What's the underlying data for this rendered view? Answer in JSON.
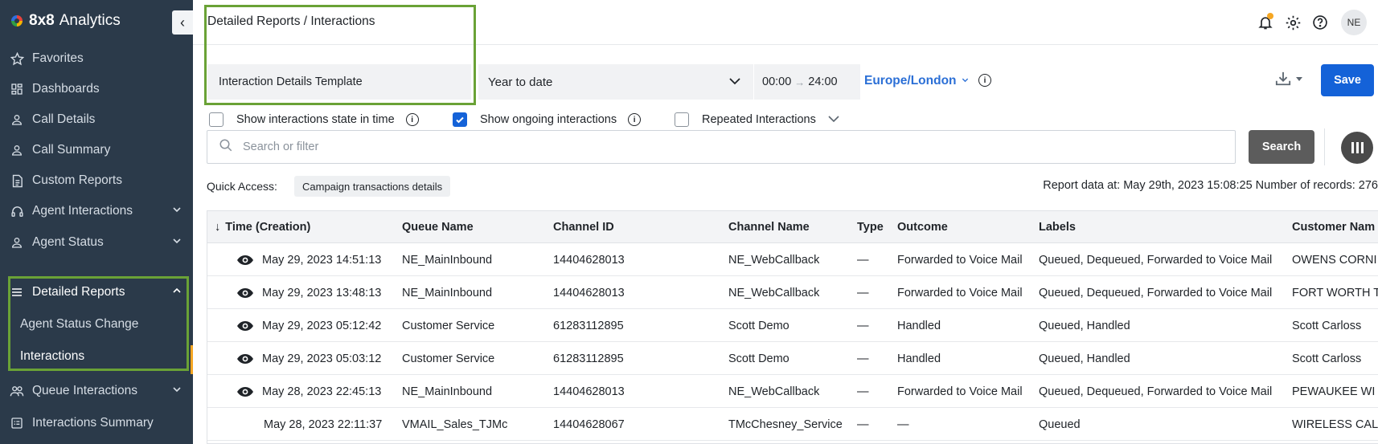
{
  "app": {
    "brand_bold": "8x8",
    "brand_name": "Analytics",
    "collapse_glyph": "‹"
  },
  "sidebar": {
    "items": [
      {
        "label": "Favorites",
        "icon": "star-icon"
      },
      {
        "label": "Dashboards",
        "icon": "dashboard-icon"
      },
      {
        "label": "Call Details",
        "icon": "person-icon"
      },
      {
        "label": "Call Summary",
        "icon": "person-icon"
      },
      {
        "label": "Custom Reports",
        "icon": "document-icon"
      },
      {
        "label": "Agent Interactions",
        "icon": "headset-icon"
      },
      {
        "label": "Agent Status",
        "icon": "person-icon"
      },
      {
        "label": "Detailed Reports",
        "icon": "list-icon"
      },
      {
        "label": "Queue Interactions",
        "icon": "group-icon"
      },
      {
        "label": "Interactions Summary",
        "icon": "summary-icon"
      }
    ],
    "sub_items": [
      {
        "label": "Agent Status Change"
      },
      {
        "label": "Interactions"
      }
    ]
  },
  "header": {
    "breadcrumb": "Detailed Reports / Interactions",
    "avatar_initials": "NE"
  },
  "filters": {
    "template": "Interaction Details Template",
    "period": "Year to date",
    "time_start": "00:00",
    "time_arrow": "→",
    "time_end": "24:00",
    "timezone": "Europe/London",
    "save_label": "Save"
  },
  "options": {
    "show_state": {
      "label": "Show interactions state in time",
      "checked": false
    },
    "show_ongoing": {
      "label": "Show ongoing interactions",
      "checked": true
    },
    "repeated": {
      "label": "Repeated Interactions",
      "checked": false
    }
  },
  "search": {
    "placeholder": "Search or filter",
    "button_label": "Search"
  },
  "quick_access": {
    "label": "Quick Access:",
    "chip": "Campaign transactions details"
  },
  "report_meta": "Report data at: May 29th, 2023 15:08:25  Number of records: 276",
  "table": {
    "sort_glyph": "↓",
    "columns": [
      "Time (Creation)",
      "Queue Name",
      "Channel ID",
      "Channel Name",
      "Type",
      "Outcome",
      "Labels",
      "Customer Nam"
    ],
    "rows": [
      {
        "has_eye": true,
        "cells": [
          "May 29, 2023 14:51:13",
          "NE_MainInbound",
          "14404628013",
          "NE_WebCallback",
          "—",
          "Forwarded to Voice Mail",
          "Queued, Dequeued, Forwarded to Voice Mail",
          "OWENS CORNI"
        ]
      },
      {
        "has_eye": true,
        "cells": [
          "May 29, 2023 13:48:13",
          "NE_MainInbound",
          "14404628013",
          "NE_WebCallback",
          "—",
          "Forwarded to Voice Mail",
          "Queued, Dequeued, Forwarded to Voice Mail",
          "FORT WORTH T"
        ]
      },
      {
        "has_eye": true,
        "cells": [
          "May 29, 2023 05:12:42",
          "Customer Service",
          "61283112895",
          "Scott Demo",
          "—",
          "Handled",
          "Queued, Handled",
          "Scott Carloss"
        ]
      },
      {
        "has_eye": true,
        "cells": [
          "May 29, 2023 05:03:12",
          "Customer Service",
          "61283112895",
          "Scott Demo",
          "—",
          "Handled",
          "Queued, Handled",
          "Scott Carloss"
        ]
      },
      {
        "has_eye": true,
        "cells": [
          "May 28, 2023 22:45:13",
          "NE_MainInbound",
          "14404628013",
          "NE_WebCallback",
          "—",
          "Forwarded to Voice Mail",
          "Queued, Dequeued, Forwarded to Voice Mail",
          "PEWAUKEE WI"
        ]
      },
      {
        "has_eye": false,
        "cells": [
          "May 28, 2023 22:11:37",
          "VMAIL_Sales_TJMc",
          "14404628067",
          "TMcChesney_Service",
          "—",
          "—",
          "Queued",
          "WIRELESS CAL"
        ]
      }
    ]
  },
  "colors": {
    "sidebar_bg": "#2b3a4a",
    "accent_blue": "#1462d8",
    "highlight_green": "#6aa236",
    "notification_orange": "#f5a623"
  }
}
